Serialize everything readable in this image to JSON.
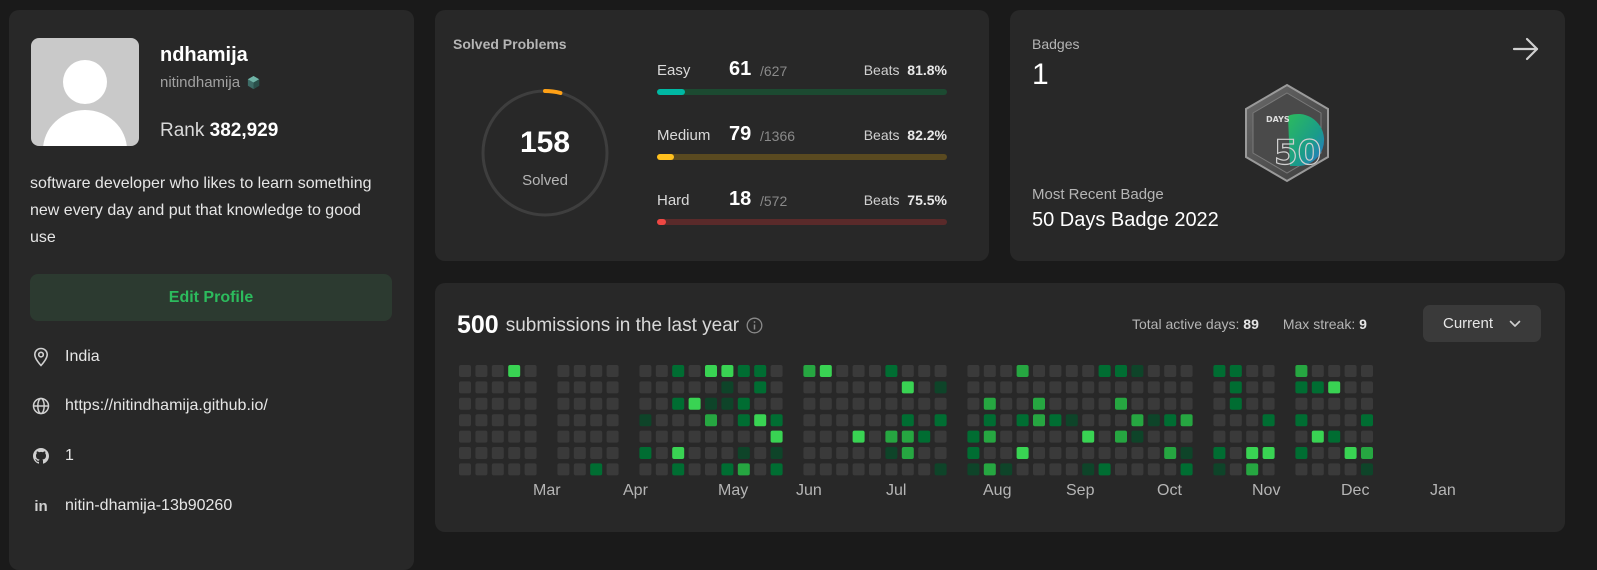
{
  "profile": {
    "username": "ndhamija",
    "handle": "nitindhamija",
    "rank_label": "Rank",
    "rank_value": "382,929",
    "bio": "software developer who likes to learn something new every day and put that knowledge to good use",
    "edit_label": "Edit Profile",
    "location": "India",
    "website": "https://nitindhamija.github.io/",
    "github": "1",
    "linkedin": "nitin-dhamija-13b90260"
  },
  "solved": {
    "title": "Solved Problems",
    "total": "158",
    "total_label": "Solved",
    "progress_fraction": 0.04,
    "difficulties": [
      {
        "label": "Easy",
        "count": "61",
        "total": "/627",
        "beats_label": "Beats",
        "beats": "81.8%",
        "fraction": 0.097,
        "color": "#00b8a3",
        "track": "#1c4a31"
      },
      {
        "label": "Medium",
        "count": "79",
        "total": "/1366",
        "beats_label": "Beats",
        "beats": "82.2%",
        "fraction": 0.058,
        "color": "#ffc01e",
        "track": "#5a4a20"
      },
      {
        "label": "Hard",
        "count": "18",
        "total": "/572",
        "beats_label": "Beats",
        "beats": "75.5%",
        "fraction": 0.031,
        "color": "#ef4743",
        "track": "#5a2a2a"
      }
    ]
  },
  "badges": {
    "label": "Badges",
    "count": "1",
    "recent_label": "Most Recent Badge",
    "recent_name": "50 Days Badge 2022",
    "badge_text": "DAYS",
    "badge_digit": "50"
  },
  "submissions": {
    "count": "500",
    "text": "submissions in the last year",
    "active_label": "Total active days:",
    "active_value": "89",
    "streak_label": "Max streak:",
    "streak_value": "9",
    "range": "Current",
    "months": [
      "Mar",
      "Apr",
      "May",
      "Jun",
      "Jul",
      "Aug",
      "Sep",
      "Oct",
      "Nov",
      "Dec",
      "Jan"
    ]
  },
  "colors": {
    "accent_green": "#2cbb5d",
    "cell_empty": "#3a3a3a",
    "cell_l1": "#0e4429",
    "cell_l2": "#006d32",
    "cell_l3": "#26a641",
    "cell_l4": "#39d353"
  }
}
